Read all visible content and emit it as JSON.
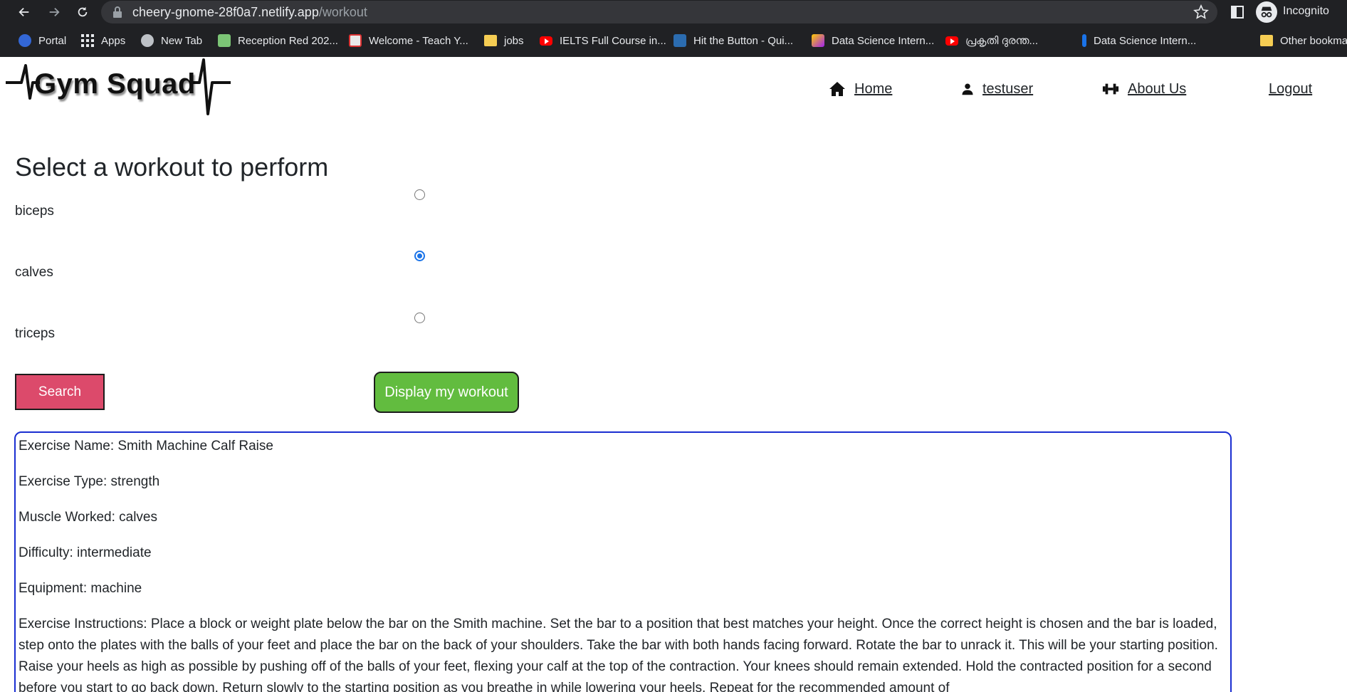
{
  "browser": {
    "url_host": "cheery-gnome-28f0a7.netlify.app",
    "url_path": "/workout",
    "profile_label": "Incognito",
    "bookmarks": [
      {
        "label": "Portal",
        "icon": "portal-icon"
      },
      {
        "label": "Apps",
        "icon": "apps-grid-icon"
      },
      {
        "label": "New Tab",
        "icon": "globe-icon"
      },
      {
        "label": "Reception Red 202...",
        "icon": "bookmark-favicon"
      },
      {
        "label": "Welcome - Teach Y...",
        "icon": "bookmark-favicon"
      },
      {
        "label": "jobs",
        "icon": "folder-icon"
      },
      {
        "label": "IELTS Full Course in...",
        "icon": "youtube-icon"
      },
      {
        "label": "Hit the Button - Qui...",
        "icon": "bookmark-favicon"
      },
      {
        "label": "Data Science Intern...",
        "icon": "bookmark-favicon"
      },
      {
        "label": "പ്രകൃതി ദുരന്ത...",
        "icon": "youtube-icon"
      },
      {
        "label": "Data Science Intern...",
        "icon": "bookmark-favicon"
      },
      {
        "label": "Other bookma",
        "icon": "folder-icon"
      }
    ]
  },
  "site": {
    "logo_text": "Gym Squad",
    "nav": {
      "home": "Home",
      "user": "testuser",
      "about": "About Us",
      "logout": "Logout"
    }
  },
  "workout": {
    "heading": "Select a workout to perform",
    "options": [
      {
        "label": "biceps",
        "checked": false
      },
      {
        "label": "calves",
        "checked": true
      },
      {
        "label": "triceps",
        "checked": false
      }
    ],
    "search_button": "Search",
    "display_button": "Display my workout"
  },
  "result": {
    "name": "Exercise Name: Smith Machine Calf Raise",
    "type": "Exercise Type: strength",
    "muscle": "Muscle Worked: calves",
    "difficulty": "Difficulty: intermediate",
    "equipment": "Equipment: machine",
    "instructions": "Exercise Instructions: Place a block or weight plate below the bar on the Smith machine. Set the bar to a position that best matches your height. Once the correct height is chosen and the bar is loaded, step onto the plates with the balls of your feet and place the bar on the back of your shoulders. Take the bar with both hands facing forward. Rotate the bar to unrack it. This will be your starting position. Raise your heels as high as possible by pushing off of the balls of your feet, flexing your calf at the top of the contraction. Your knees should remain extended. Hold the contracted position for a second before you start to go back down. Return slowly to the starting position as you breathe in while lowering your heels. Repeat for the recommended amount of"
  },
  "colors": {
    "search_button": "#dc4a6b",
    "display_button": "#62bc3f",
    "result_border": "#1a2ed1",
    "radio_accent": "#1a73e8"
  }
}
